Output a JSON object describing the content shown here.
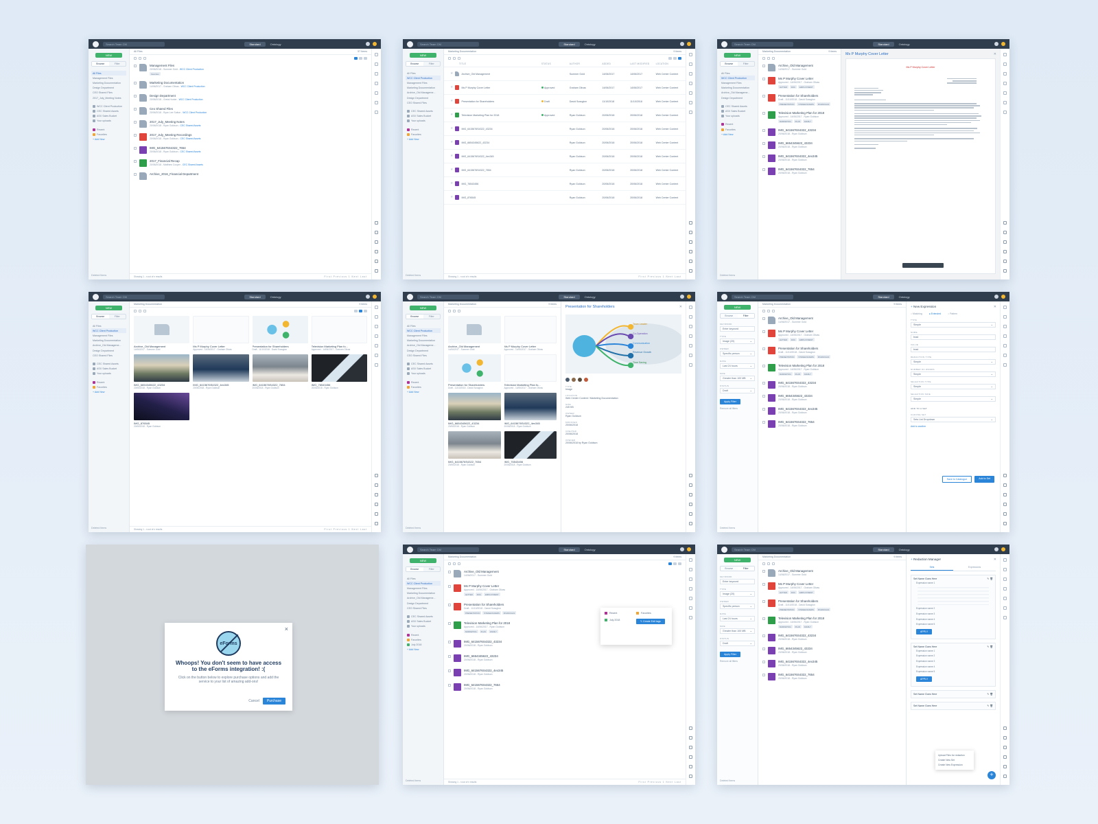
{
  "common": {
    "search_placeholder": "Search Team CM",
    "view_standard": "Standard",
    "view_ontology": "Ontology",
    "new_label": "NEW",
    "browse_tab": "Browse",
    "filter_tab": "Filter",
    "deleted_items": "Deleted Items",
    "showing": "Showing 1 - n out of n results",
    "pagination": "First  Previous  1  Next  Last"
  },
  "screen1": {
    "crumb": "All Files",
    "count": "57 Items",
    "sidebar": [
      "All Files",
      "Management Files",
      "Marketing Documentation",
      "Design Department",
      "CEO Shared Files",
      "2017_July_Meeting Notes",
      "WCC Client Production",
      "CEC Shared Assets",
      "ASX Sales Bucket",
      "Your uploads",
      "Recent",
      "Favorites",
      "+ Add New"
    ],
    "items": [
      {
        "title": "Management Files",
        "sub": "20/06/2018 - Summer Gold",
        "link": "WCC Client Production",
        "tag": "Favorites",
        "icon": "folder"
      },
      {
        "title": "Marketing Documentation",
        "sub": "14/06/2017 - Graham Olivas",
        "link": "WCC Client Production",
        "icon": "folder"
      },
      {
        "title": "Design Department",
        "sub": "20/06/2018 - Greta Hunter",
        "link": "WCC Client Production",
        "icon": "folder"
      },
      {
        "title": "Ceo Shared Files",
        "sub": "20/06/2018 - Ryan Lee Sutton",
        "link": "WCC Client Production",
        "icon": "folder"
      },
      {
        "title": "2017_July_Meeting Notes",
        "sub": "20/06/2018 - Ryan Goldson",
        "link": "CEC Shared Assets",
        "icon": "folder"
      },
      {
        "title": "2017_July_Meeting Recordings",
        "sub": "20/06/2018 - Ryan Goldson",
        "link": "CEC Shared Assets",
        "icon": "pdf"
      },
      {
        "title": "IMG_6415676S4322_7654",
        "sub": "20/06/2018 - Ryan Goldson",
        "link": "CEC Shared Assets",
        "icon": "img"
      },
      {
        "title": "2017_Financial Recap",
        "sub": "20/06/2018 - Matthew Cooper",
        "link": "CEC Shared Assets",
        "icon": "xls"
      },
      {
        "title": "Archive_2016_Financial Department",
        "sub": "",
        "link": "",
        "icon": "folder"
      }
    ]
  },
  "screen2": {
    "crumb": "Marketing Documentation",
    "count": "9 items",
    "headers": [
      "TITLE",
      "STATUS",
      "AUTHOR",
      "ADDED",
      "LAST MODIFIED",
      "LOCATION"
    ],
    "sidebar": [
      "All Files",
      "WCC Client Production",
      "Management Files",
      "Marketing Documentation",
      "Archive_Old Manageme...",
      "Design Department",
      "CEO Shared Files",
      "CEC Shared Assets",
      "ASX Sales Bucket",
      "Your uploads",
      "Recent",
      "Favorites",
      "+ Add New"
    ],
    "rows": [
      {
        "title": "Archive_Old Management",
        "status": "",
        "author": "Summer Gold",
        "added": "14/06/2017",
        "mod": "14/06/2017",
        "loc": "Web Center Content",
        "icon": "folder"
      },
      {
        "title": "Ms P Murphy Cover Letter",
        "status": "Approved",
        "author": "Graham Olivas",
        "added": "14/06/2017",
        "mod": "14/06/2017",
        "loc": "Web Center Content",
        "icon": "pdf"
      },
      {
        "title": "Presentation for Shareholders",
        "status": "Draft",
        "author": "David Sussgton",
        "added": "11/10/2018",
        "mod": "11/10/2018",
        "loc": "Web Center Content",
        "icon": "pdf"
      },
      {
        "title": "Television Marketing Plan for 2018",
        "status": "Approved",
        "author": "Ryan Goldson",
        "added": "20/06/2018",
        "mod": "20/06/2018",
        "loc": "Web Center Content",
        "icon": "xls"
      },
      {
        "title": "IMG_6415676S4322_43234",
        "status": "",
        "author": "Ryan Goldson",
        "added": "20/06/2018",
        "mod": "20/06/2018",
        "loc": "Web Center Content",
        "icon": "img"
      },
      {
        "title": "IMG_6654345622_43234",
        "status": "",
        "author": "Ryan Goldson",
        "added": "20/06/2018",
        "mod": "20/06/2018",
        "loc": "Web Center Content",
        "icon": "img"
      },
      {
        "title": "IMG_6415676S4322_4ex345",
        "status": "",
        "author": "Ryan Goldson",
        "added": "20/06/2018",
        "mod": "20/06/2018",
        "loc": "Web Center Content",
        "icon": "img"
      },
      {
        "title": "IMG_6415676S4322_7654",
        "status": "",
        "author": "Ryan Goldson",
        "added": "20/06/2018",
        "mod": "20/06/2018",
        "loc": "Web Center Content",
        "icon": "img"
      },
      {
        "title": "IMG_76543456",
        "status": "",
        "author": "Ryan Goldson",
        "added": "20/06/2018",
        "mod": "20/06/2018",
        "loc": "Web Center Content",
        "icon": "img"
      },
      {
        "title": "IMG_876545",
        "status": "",
        "author": "Ryan Goldson",
        "added": "20/06/2018",
        "mod": "20/06/2018",
        "loc": "Web Center Content",
        "icon": "img"
      }
    ]
  },
  "screen3": {
    "preview_title": "Ms P Murphy Cover Letter",
    "letter_heading": "Ms P Murphy Cover Letter",
    "items": [
      {
        "title": "Archive_Old Management",
        "sub": "14/06/2017 - Summer Gold",
        "icon": "folder"
      },
      {
        "title": "Ms P Murphy Cover Letter",
        "sub": "Approved - 14/06/2017 - Graham Olivas",
        "icon": "pdf",
        "tags": [
          "LETTER",
          "DOC",
          "EMPLOYMENT"
        ]
      },
      {
        "title": "Presentation for Shareholders",
        "sub": "Draft - 11/10/2018 - David Sussgton",
        "icon": "pdf",
        "tags": [
          "PRESENTATION",
          "STAKEHOLDERS",
          "FINANCIALS"
        ]
      },
      {
        "title": "Television Marketing Plan for 2018",
        "sub": "Approved - 14/06/2017 - Ryan Goldson",
        "icon": "xls",
        "tags": [
          "MARKETING",
          "PLAN",
          "FAMILY"
        ]
      },
      {
        "title": "IMG_6415676S4322_43234",
        "sub": "20/06/2018 - Ryan Goldson",
        "icon": "img"
      },
      {
        "title": "IMG_6654345622_43234",
        "sub": "20/06/2018 - Ryan Goldson",
        "icon": "img"
      },
      {
        "title": "IMG_6415676S4322_4ex345",
        "sub": "20/06/2018 - Ryan Goldson",
        "icon": "img"
      },
      {
        "title": "IMG_6415676S4322_7654",
        "sub": "20/06/2018 - Ryan Goldson",
        "icon": "img"
      }
    ]
  },
  "screen4": {
    "cards": [
      {
        "title": "Archive_Old Management",
        "sub": "14/06/2017 - Summer Gold",
        "thumb": "folder"
      },
      {
        "title": "Ms P Murphy Cover Letter",
        "sub": "Approved - 14/06/2017 - Graham Olivas",
        "thumb": "doc"
      },
      {
        "title": "Presentation for Shareholders",
        "sub": "Draft - 11/10/2018 - David Sussgton",
        "thumb": "chart"
      },
      {
        "title": "Television Marketing Plan fo...",
        "sub": "Approved - 14/06/2017 - Graham Olivas",
        "thumb": "doc"
      },
      {
        "title": "IMG_6654345622_43234",
        "sub": "20/06/2018 - Ryan Goldson",
        "thumb": "coast"
      },
      {
        "title": "IMG_6415676S4322_4ex345",
        "sub": "20/06/2018 - Ryan Goldson",
        "thumb": "team"
      },
      {
        "title": "IMG_6415676S4322_7654",
        "sub": "20/06/2018 - Ryan Goldson",
        "thumb": "beach"
      },
      {
        "title": "IMG_76543456",
        "sub": "20/06/2018 - Ryan Goldson",
        "thumb": "window"
      },
      {
        "title": "IMG_876545",
        "sub": "20/06/2018 - Ryan Goldson",
        "thumb": "night"
      }
    ]
  },
  "screen5": {
    "preview_title": "Presentation for Shareholders",
    "chart_labels": [
      "Team Leader",
      "Co-Operation",
      "Communication",
      "Revenue Growth",
      "Time Saving"
    ],
    "meta": [
      {
        "label": "TYPE",
        "value": "Image"
      },
      {
        "label": "LOCATION",
        "value": "Web Center Content / Marketing Documentation"
      },
      {
        "label": "SIZE",
        "value": "245 KB"
      },
      {
        "label": "OWNER",
        "value": "Ryan Goldson"
      },
      {
        "label": "MODIFIED",
        "value": "20/06/2018"
      },
      {
        "label": "CREATED",
        "value": "20/06/2018"
      },
      {
        "label": "OPENED",
        "value": "20/06/2018 by Ryan Goldson"
      }
    ]
  },
  "screen6": {
    "panel_title": "New Expression",
    "modes": [
      "Matching",
      "Extended",
      "Pattern"
    ],
    "filters": [
      {
        "label": "KEYWORD",
        "value": "Enter keyword"
      },
      {
        "label": "TYPE",
        "value": "Image (20)"
      },
      {
        "label": "OWNER",
        "value": "Specific person"
      },
      {
        "label": "DATE",
        "value": "Last 24 hours"
      },
      {
        "label": "SIZE",
        "value": "Greater than 100 MB"
      },
      {
        "label": "STATUS",
        "value": "Draft"
      }
    ],
    "apply_filter": "Apply Filter",
    "remove_filters": "Remove all filters",
    "fields": [
      {
        "label": "TYPE",
        "value": "Simple"
      },
      {
        "label": "NAME",
        "value": "brad"
      },
      {
        "label": "VALUE",
        "value": "brad"
      },
      {
        "label": "REDACTION TYPE",
        "value": "Simple"
      },
      {
        "label": "NUMBER OF WORDS",
        "value": "Simple"
      },
      {
        "label": "SELECTION TYPE",
        "value": "Simple"
      },
      {
        "label": "SELECTION SIDE",
        "value": "Simple"
      }
    ],
    "add_to_set": "ADD TO A SET",
    "choose_set": "CHOOSE SET",
    "sets_dropdown": "Sets List Dropdown",
    "add_another": "Add to another",
    "save_catalogue": "Save to Catalogue",
    "add_to_set_btn": "Add to Set"
  },
  "screen7": {
    "title": "Whoops! You don't seem to have access to the eForms integration! :(",
    "body": "Click on the button below to explore purchase options and add the service to your list of amazing add-ons!",
    "cancel": "Cancel",
    "purchase": "Purchase",
    "icon_label": "eForms"
  },
  "screen8": {
    "popover": [
      "Recent",
      "Favorites",
      "July 2018"
    ],
    "create_tag": "Create Edit tags",
    "sidebar_extra": "July 2018"
  },
  "screen9": {
    "panel_title": "Redaction Manager",
    "tabs": [
      "Sets",
      "Expressions"
    ],
    "set_name": "Set Name Goes Here",
    "expressions": [
      "Expression name 1",
      "Expression name 2",
      "Expression name 3",
      "Expression name 4",
      "Expression name 5"
    ],
    "apply": "APPLY",
    "menu": [
      "Upload Files for redaction",
      "Create New Set",
      "Create New Expression"
    ]
  }
}
